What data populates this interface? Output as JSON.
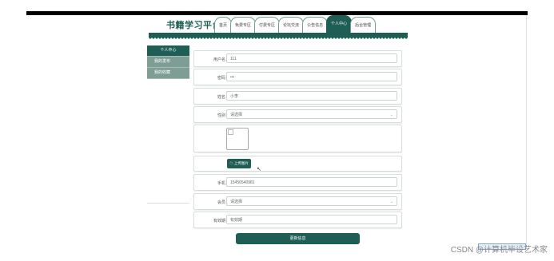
{
  "site_title": "书籍学习平台",
  "nav": [
    "首页",
    "免费专区",
    "付费专区",
    "论坛交流",
    "公告信息",
    "个人中心",
    "后台管理"
  ],
  "nav_active_index": 5,
  "sidebar": [
    "个人中心",
    "我的发布",
    "我的收藏"
  ],
  "form": {
    "username_label": "用户名",
    "username_value": "111",
    "password_label": "密码",
    "password_value": "•••",
    "name_label": "姓名",
    "name_value": "小李",
    "gender_label": "性别",
    "gender_placeholder": "请选择",
    "upload_label": "上传图片",
    "phone_label": "手机",
    "phone_value": "15456540981",
    "member_label": "会员",
    "member_placeholder": "请选择",
    "expiry_label": "有效期",
    "expiry_value": "有效期",
    "submit_label": "更新信息"
  },
  "watermark": "CSDN @计算机毕设艺术家",
  "colors": {
    "brand": "#1e5e54",
    "sidebar": "#7e9e95"
  }
}
